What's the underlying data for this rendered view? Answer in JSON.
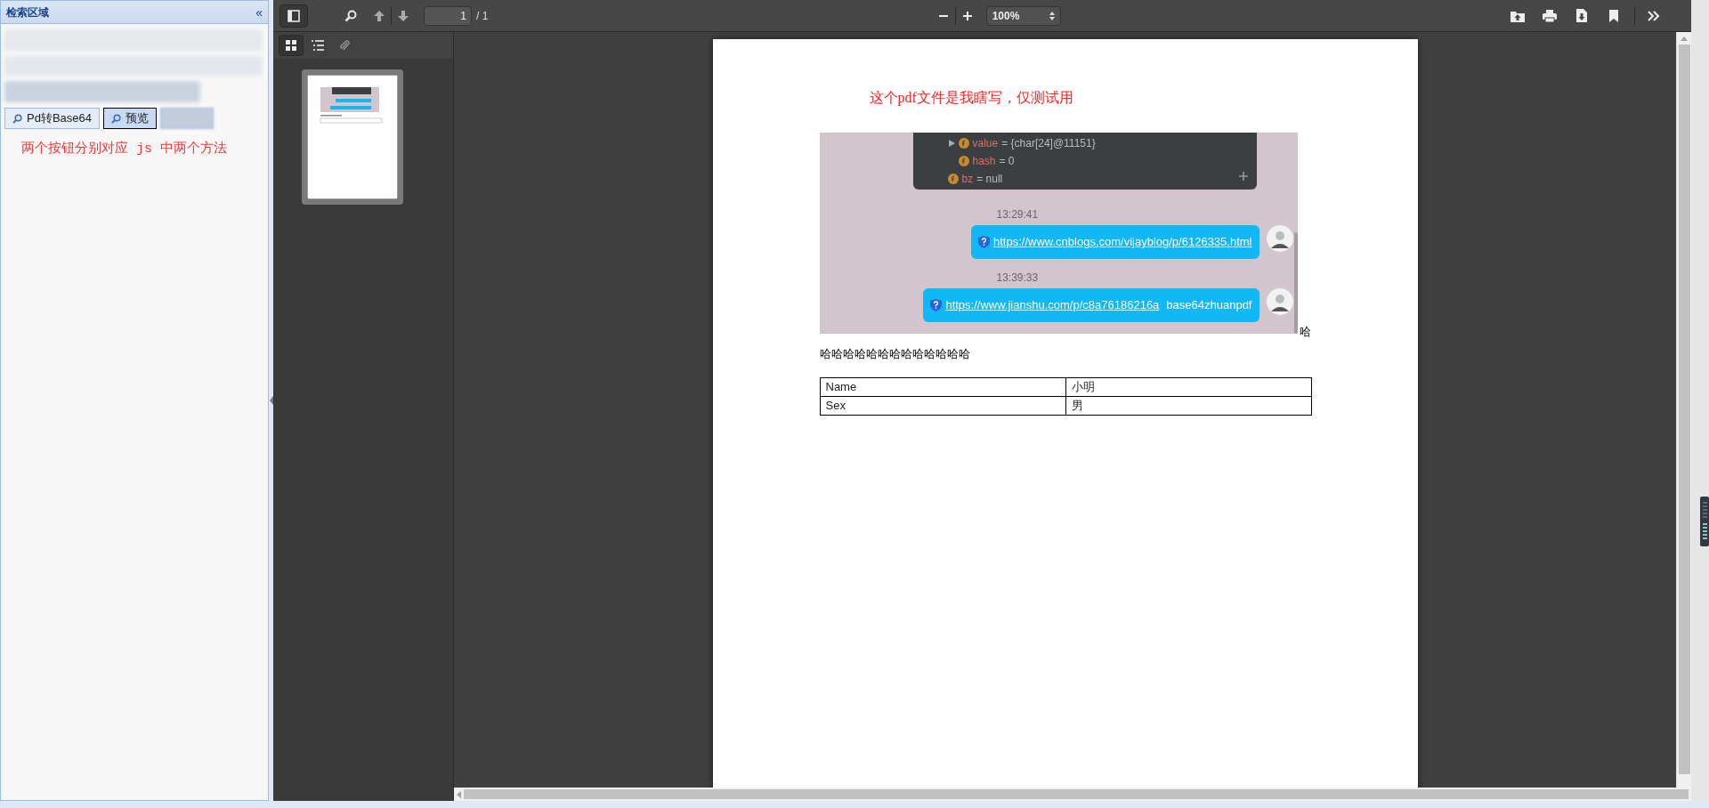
{
  "left_panel": {
    "title": "检索区域",
    "collapse": "«",
    "buttons": [
      {
        "label": "Pd转Base64",
        "selected": false
      },
      {
        "label": "预览",
        "selected": true
      }
    ],
    "note": "两个按钮分别对应 js 中两个方法"
  },
  "viewer_toolbar": {
    "page_number": "1",
    "page_count": "/ 1",
    "zoom": "100%"
  },
  "sidebar_tabs": [
    {
      "kind": "thumbnails",
      "selected": true
    },
    {
      "kind": "outline",
      "selected": false
    },
    {
      "kind": "attachments",
      "selected": false
    }
  ],
  "document": {
    "heading": "这个pdf文件是我瞎写，仅测试用",
    "chat": {
      "nested_fields": [
        {
          "name": "value",
          "value": "= {char[24]@11151}",
          "expandable": true
        },
        {
          "name": "hash",
          "value": "= 0",
          "expandable": false
        }
      ],
      "fields": [
        {
          "name": "bz",
          "value": "= null",
          "expandable": false
        }
      ],
      "messages": [
        {
          "time": "13:29:41",
          "link": "https://www.cnblogs.com/vijayblog/p/6126335.html"
        },
        {
          "time": "13:39:33",
          "link": "https://www.jianshu.com/p/c8a76186216a",
          "text": "base64zhuanpdf"
        }
      ]
    },
    "overflow_char": "哈",
    "line": "哈哈哈哈哈哈哈哈哈哈哈哈哈",
    "table": {
      "rows": [
        [
          "Name",
          "小明"
        ],
        [
          "Sex",
          "男"
        ]
      ]
    }
  }
}
